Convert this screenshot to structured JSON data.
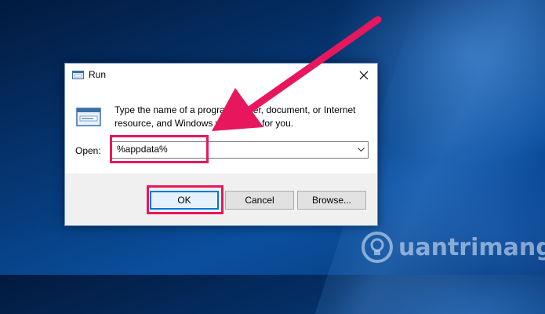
{
  "dialog": {
    "title": "Run",
    "description": "Type the name of a program, folder, document, or Internet resource, and Windows will open it for you.",
    "open_label": "Open:",
    "open_value": "%appdata%",
    "buttons": {
      "ok": "OK",
      "cancel": "Cancel",
      "browse": "Browse..."
    }
  },
  "watermark": {
    "text": "uantrimang"
  },
  "colors": {
    "highlight": "#e8175d",
    "accent": "#0078d7"
  },
  "icons": [
    "run-app-icon",
    "close-icon",
    "chevron-down-icon",
    "annotation-arrow",
    "lightbulb-icon"
  ]
}
